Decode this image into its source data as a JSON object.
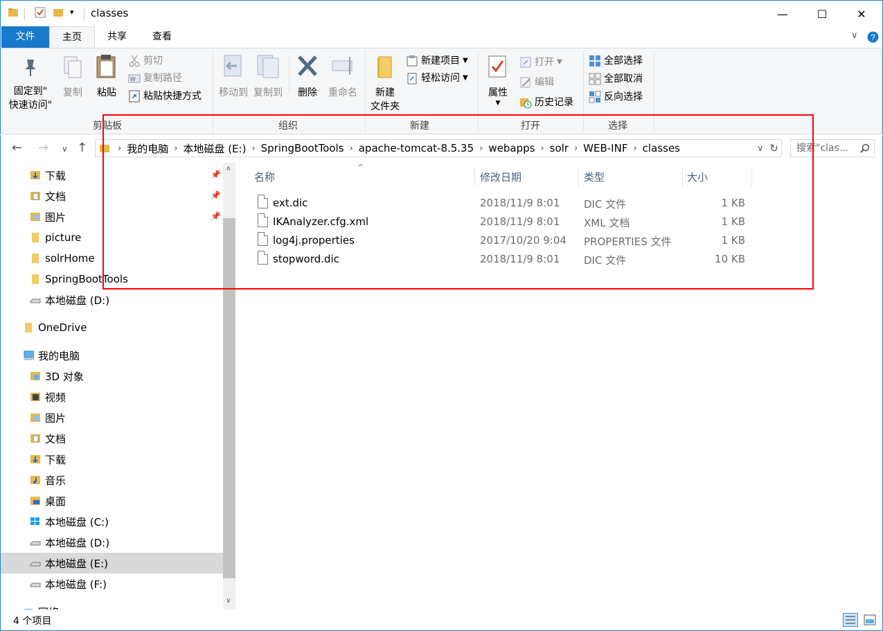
{
  "window": {
    "title": "classes",
    "minimize": "—",
    "maximize": "☐",
    "close": "✕"
  },
  "ribbon_tabs": [
    "文件",
    "主页",
    "共享",
    "查看"
  ],
  "ribbon": {
    "clipboard": {
      "pin_label_1": "固定到\"",
      "pin_label_2": "快速访问\"",
      "copy": "复制",
      "paste": "粘贴",
      "cut": "剪切",
      "copy_path": "复制路径",
      "paste_shortcut": "粘贴快捷方式",
      "group_label": "剪贴板"
    },
    "organize": {
      "move_to": "移动到",
      "copy_to": "复制到",
      "delete": "删除",
      "rename": "重命名",
      "group_label": "组织"
    },
    "new": {
      "new_folder_1": "新建",
      "new_folder_2": "文件夹",
      "new_item": "新建项目",
      "easy_access": "轻松访问",
      "group_label": "新建"
    },
    "open": {
      "properties": "属性",
      "open": "打开",
      "edit": "编辑",
      "history": "历史记录",
      "group_label": "打开"
    },
    "select": {
      "select_all": "全部选择",
      "select_none": "全部取消",
      "invert": "反向选择",
      "group_label": "选择"
    }
  },
  "address": {
    "crumbs": [
      "我的电脑",
      "本地磁盘 (E:)",
      "SpringBootTools",
      "apache-tomcat-8.5.35",
      "webapps",
      "solr",
      "WEB-INF",
      "classes"
    ],
    "search_placeholder": "搜索\"clas..."
  },
  "sidebar": {
    "quick_access": [
      {
        "label": "下载",
        "pinned": true
      },
      {
        "label": "文档",
        "pinned": true
      },
      {
        "label": "图片",
        "pinned": true
      },
      {
        "label": "picture",
        "pinned": false
      },
      {
        "label": "solrHome",
        "pinned": false
      },
      {
        "label": "SpringBootTools",
        "pinned": false
      },
      {
        "label": "本地磁盘 (D:)",
        "pinned": false
      }
    ],
    "onedrive": "OneDrive",
    "this_pc": "我的电脑",
    "pc_items": [
      "3D 对象",
      "视频",
      "图片",
      "文档",
      "下载",
      "音乐",
      "桌面",
      "本地磁盘 (C:)",
      "本地磁盘 (D:)",
      "本地磁盘 (E:)",
      "本地磁盘 (F:)"
    ],
    "selected": "本地磁盘 (E:)",
    "network": "网络"
  },
  "columns": {
    "name": "名称",
    "date": "修改日期",
    "type": "类型",
    "size": "大小"
  },
  "files": [
    {
      "name": "ext.dic",
      "date": "2018/11/9 8:01",
      "type": "DIC 文件",
      "size": "1 KB"
    },
    {
      "name": "IKAnalyzer.cfg.xml",
      "date": "2018/11/9 8:01",
      "type": "XML 文档",
      "size": "1 KB"
    },
    {
      "name": "log4j.properties",
      "date": "2017/10/20 9:04",
      "type": "PROPERTIES 文件",
      "size": "1 KB"
    },
    {
      "name": "stopword.dic",
      "date": "2018/11/9 8:01",
      "type": "DIC 文件",
      "size": "10 KB"
    }
  ],
  "status": {
    "count": "4 个项目"
  },
  "colors": {
    "accent": "#1979ca",
    "highlight_box": "#ff0000",
    "folder": "#e8b84a"
  }
}
